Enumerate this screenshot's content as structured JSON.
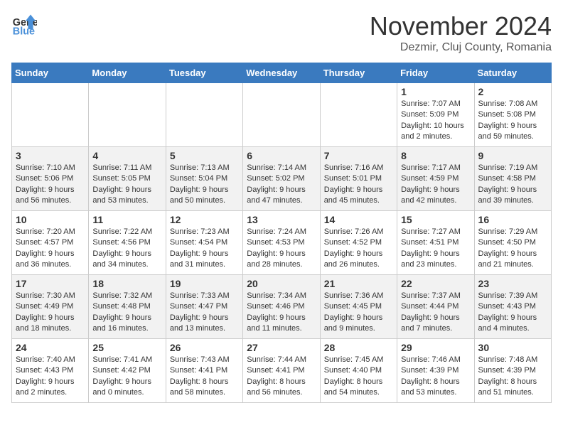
{
  "header": {
    "logo_line1": "General",
    "logo_line2": "Blue",
    "month": "November 2024",
    "location": "Dezmir, Cluj County, Romania"
  },
  "weekdays": [
    "Sunday",
    "Monday",
    "Tuesday",
    "Wednesday",
    "Thursday",
    "Friday",
    "Saturday"
  ],
  "weeks": [
    [
      {
        "day": "",
        "info": ""
      },
      {
        "day": "",
        "info": ""
      },
      {
        "day": "",
        "info": ""
      },
      {
        "day": "",
        "info": ""
      },
      {
        "day": "",
        "info": ""
      },
      {
        "day": "1",
        "info": "Sunrise: 7:07 AM\nSunset: 5:09 PM\nDaylight: 10 hours and 2 minutes."
      },
      {
        "day": "2",
        "info": "Sunrise: 7:08 AM\nSunset: 5:08 PM\nDaylight: 9 hours and 59 minutes."
      }
    ],
    [
      {
        "day": "3",
        "info": "Sunrise: 7:10 AM\nSunset: 5:06 PM\nDaylight: 9 hours and 56 minutes."
      },
      {
        "day": "4",
        "info": "Sunrise: 7:11 AM\nSunset: 5:05 PM\nDaylight: 9 hours and 53 minutes."
      },
      {
        "day": "5",
        "info": "Sunrise: 7:13 AM\nSunset: 5:04 PM\nDaylight: 9 hours and 50 minutes."
      },
      {
        "day": "6",
        "info": "Sunrise: 7:14 AM\nSunset: 5:02 PM\nDaylight: 9 hours and 47 minutes."
      },
      {
        "day": "7",
        "info": "Sunrise: 7:16 AM\nSunset: 5:01 PM\nDaylight: 9 hours and 45 minutes."
      },
      {
        "day": "8",
        "info": "Sunrise: 7:17 AM\nSunset: 4:59 PM\nDaylight: 9 hours and 42 minutes."
      },
      {
        "day": "9",
        "info": "Sunrise: 7:19 AM\nSunset: 4:58 PM\nDaylight: 9 hours and 39 minutes."
      }
    ],
    [
      {
        "day": "10",
        "info": "Sunrise: 7:20 AM\nSunset: 4:57 PM\nDaylight: 9 hours and 36 minutes."
      },
      {
        "day": "11",
        "info": "Sunrise: 7:22 AM\nSunset: 4:56 PM\nDaylight: 9 hours and 34 minutes."
      },
      {
        "day": "12",
        "info": "Sunrise: 7:23 AM\nSunset: 4:54 PM\nDaylight: 9 hours and 31 minutes."
      },
      {
        "day": "13",
        "info": "Sunrise: 7:24 AM\nSunset: 4:53 PM\nDaylight: 9 hours and 28 minutes."
      },
      {
        "day": "14",
        "info": "Sunrise: 7:26 AM\nSunset: 4:52 PM\nDaylight: 9 hours and 26 minutes."
      },
      {
        "day": "15",
        "info": "Sunrise: 7:27 AM\nSunset: 4:51 PM\nDaylight: 9 hours and 23 minutes."
      },
      {
        "day": "16",
        "info": "Sunrise: 7:29 AM\nSunset: 4:50 PM\nDaylight: 9 hours and 21 minutes."
      }
    ],
    [
      {
        "day": "17",
        "info": "Sunrise: 7:30 AM\nSunset: 4:49 PM\nDaylight: 9 hours and 18 minutes."
      },
      {
        "day": "18",
        "info": "Sunrise: 7:32 AM\nSunset: 4:48 PM\nDaylight: 9 hours and 16 minutes."
      },
      {
        "day": "19",
        "info": "Sunrise: 7:33 AM\nSunset: 4:47 PM\nDaylight: 9 hours and 13 minutes."
      },
      {
        "day": "20",
        "info": "Sunrise: 7:34 AM\nSunset: 4:46 PM\nDaylight: 9 hours and 11 minutes."
      },
      {
        "day": "21",
        "info": "Sunrise: 7:36 AM\nSunset: 4:45 PM\nDaylight: 9 hours and 9 minutes."
      },
      {
        "day": "22",
        "info": "Sunrise: 7:37 AM\nSunset: 4:44 PM\nDaylight: 9 hours and 7 minutes."
      },
      {
        "day": "23",
        "info": "Sunrise: 7:39 AM\nSunset: 4:43 PM\nDaylight: 9 hours and 4 minutes."
      }
    ],
    [
      {
        "day": "24",
        "info": "Sunrise: 7:40 AM\nSunset: 4:43 PM\nDaylight: 9 hours and 2 minutes."
      },
      {
        "day": "25",
        "info": "Sunrise: 7:41 AM\nSunset: 4:42 PM\nDaylight: 9 hours and 0 minutes."
      },
      {
        "day": "26",
        "info": "Sunrise: 7:43 AM\nSunset: 4:41 PM\nDaylight: 8 hours and 58 minutes."
      },
      {
        "day": "27",
        "info": "Sunrise: 7:44 AM\nSunset: 4:41 PM\nDaylight: 8 hours and 56 minutes."
      },
      {
        "day": "28",
        "info": "Sunrise: 7:45 AM\nSunset: 4:40 PM\nDaylight: 8 hours and 54 minutes."
      },
      {
        "day": "29",
        "info": "Sunrise: 7:46 AM\nSunset: 4:39 PM\nDaylight: 8 hours and 53 minutes."
      },
      {
        "day": "30",
        "info": "Sunrise: 7:48 AM\nSunset: 4:39 PM\nDaylight: 8 hours and 51 minutes."
      }
    ]
  ]
}
